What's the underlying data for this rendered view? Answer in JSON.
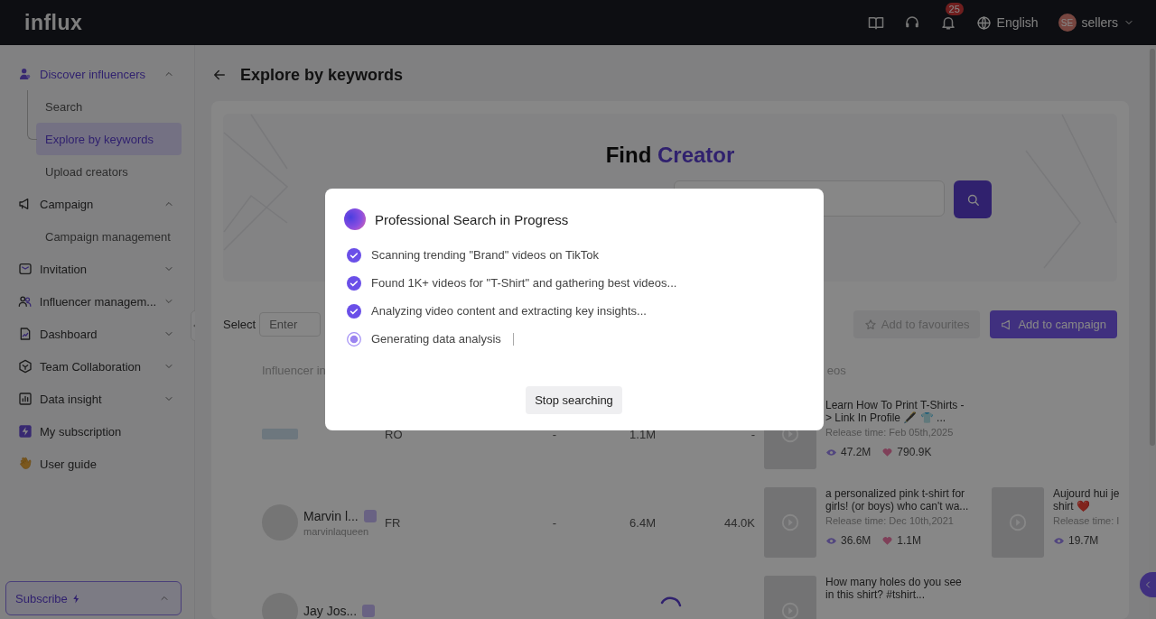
{
  "header": {
    "logo": "influx",
    "notifications": "25",
    "language": "English",
    "user_initials": "SE",
    "user_name": "sellers"
  },
  "sidebar": {
    "items": [
      {
        "kind": "group",
        "label": "Discover influencers",
        "selected": true,
        "expanded": true,
        "children": [
          {
            "label": "Search",
            "selected": false
          },
          {
            "label": "Explore by keywords",
            "selected": true
          },
          {
            "label": "Upload creators",
            "selected": false
          }
        ]
      },
      {
        "kind": "group",
        "label": "Campaign",
        "selected": false,
        "expanded": true,
        "children": [
          {
            "label": "Campaign management",
            "selected": false
          }
        ]
      },
      {
        "kind": "group",
        "label": "Invitation",
        "selected": false,
        "expanded": false
      },
      {
        "kind": "group",
        "label": "Influencer managem...",
        "selected": false,
        "expanded": false
      },
      {
        "kind": "group",
        "label": "Dashboard",
        "selected": false,
        "expanded": false
      },
      {
        "kind": "group",
        "label": "Team Collaboration",
        "selected": false,
        "expanded": false
      },
      {
        "kind": "group",
        "label": "Data insight",
        "selected": false,
        "expanded": false
      },
      {
        "kind": "link",
        "label": "My subscription",
        "selected": false
      },
      {
        "kind": "link",
        "label": "User guide",
        "selected": false
      }
    ],
    "subscribe": "Subscribe"
  },
  "page": {
    "title": "Explore by keywords",
    "hero_title": "Find **Creator**",
    "select_label": "Select",
    "select_placeholder": "Enter",
    "buttons": [
      {
        "label": "Add to favourites",
        "disabled": true
      },
      {
        "label": "Add to campaign",
        "disabled": false
      }
    ],
    "columns": [
      "Influencer in",
      "eos"
    ],
    "rows": [
      {
        "country": "RO",
        "col_3": "-",
        "followers": "1.1M",
        "col_5": "-",
        "videos": [
          {
            "title": "Learn How To Print T-Shirts -> Link In Profile 🖋️ 👕 ...",
            "release": "Release time: Feb 05th,2025",
            "views": "47.2M",
            "likes": "790.9K"
          }
        ]
      },
      {
        "name": "Marvin l...",
        "checked": false,
        "handle": "marvinlaqueen",
        "country": "FR",
        "col_3": "-",
        "followers": "6.4M",
        "col_5": "44.0K",
        "videos": [
          {
            "title": "a personalized pink t-shirt for girls! (or boys) who can't wa...",
            "release": "Release time: Dec 10th,2021",
            "views": "36.6M",
            "likes": "1.1M"
          },
          {
            "title": "Aujourd hui je shirt ❤️",
            "release": "Release time: I",
            "views": "19.7M"
          }
        ]
      },
      {
        "name": "Jay Jos...",
        "checked": false,
        "videos": [
          {
            "title": "How many holes do you see in this shirt? #tshirt..."
          }
        ]
      }
    ]
  },
  "modal": {
    "title": "Professional Search in Progress",
    "steps": [
      {
        "text": "Scanning trending \"Brand\" videos on TikTok",
        "done": true
      },
      {
        "text": "Found 1K+ videos for \"T-Shirt\" and gathering best videos...",
        "done": true
      },
      {
        "text": "Analyzing video content and extracting key insights...",
        "done": true
      },
      {
        "text": "Generating data analysis",
        "done": false
      }
    ],
    "button": "Stop searching"
  }
}
